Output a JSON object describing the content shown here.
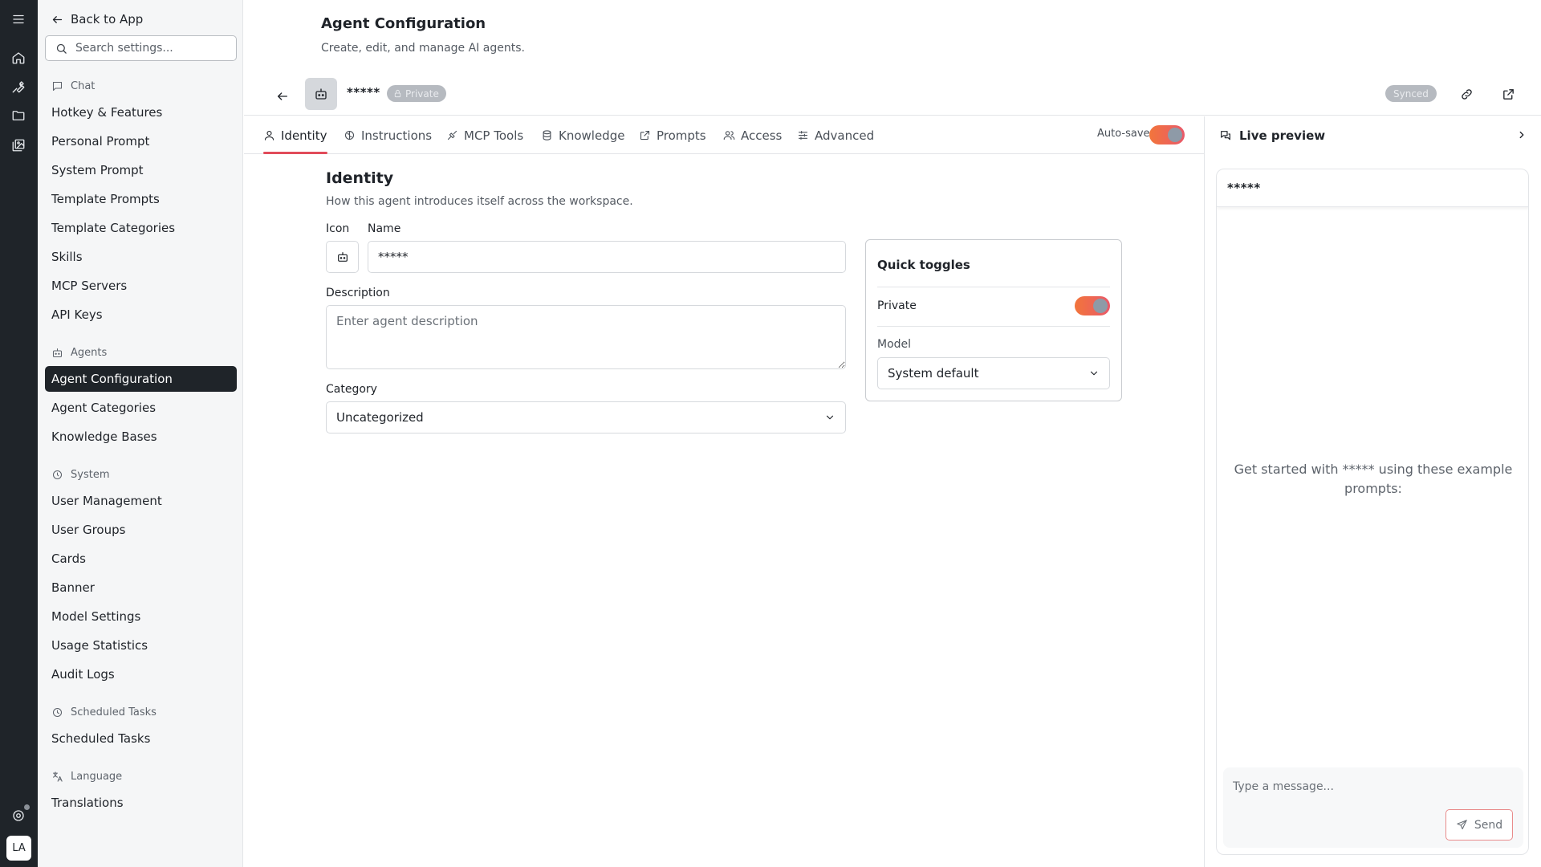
{
  "rail": {
    "avatar_initials": "LA",
    "icons": [
      "menu-icon",
      "home-icon",
      "wrench-icon",
      "folder-icon",
      "gallery-icon",
      "support-icon"
    ]
  },
  "sidebar": {
    "back_label": "Back to App",
    "search_placeholder": "Search settings...",
    "sections": {
      "chat": "Chat",
      "agents": "Agents",
      "system": "System",
      "scheduled": "Scheduled Tasks",
      "language": "Language"
    },
    "items": {
      "hotkey": "Hotkey & Features",
      "personal_prompt": "Personal Prompt",
      "system_prompt": "System Prompt",
      "template_prompts": "Template Prompts",
      "template_categories": "Template Categories",
      "skills": "Skills",
      "mcp_servers": "MCP Servers",
      "api_keys": "API Keys",
      "agent_configuration": "Agent Configuration",
      "agent_categories": "Agent Categories",
      "knowledge_bases": "Knowledge Bases",
      "user_management": "User Management",
      "user_groups": "User Groups",
      "cards": "Cards",
      "banner": "Banner",
      "model_settings": "Model Settings",
      "usage_statistics": "Usage Statistics",
      "audit_logs": "Audit Logs",
      "scheduled_tasks": "Scheduled Tasks",
      "translations": "Translations"
    },
    "active_item": "Agent Configuration"
  },
  "header": {
    "title": "Agent Configuration",
    "subtitle": "Create, edit, and manage AI agents."
  },
  "agent_bar": {
    "name": "*****",
    "private_badge": "Private",
    "synced_badge": "Synced"
  },
  "tabs": {
    "identity": "Identity",
    "instructions": "Instructions",
    "mcp_tools": "MCP Tools",
    "knowledge": "Knowledge",
    "prompts": "Prompts",
    "access": "Access",
    "advanced": "Advanced",
    "active": "Identity",
    "autosave_label": "Auto-save",
    "autosave_on": true
  },
  "identity": {
    "title": "Identity",
    "subtitle": "How this agent introduces itself across the workspace.",
    "icon_label": "Icon",
    "name_label": "Name",
    "name_value": "*****",
    "description_label": "Description",
    "description_placeholder": "Enter agent description",
    "category_label": "Category",
    "category_value": "Uncategorized"
  },
  "quick_toggles": {
    "title": "Quick toggles",
    "private_label": "Private",
    "private_on": true,
    "model_label": "Model",
    "model_value": "System default"
  },
  "preview": {
    "title": "Live preview",
    "agent_name": "*****",
    "empty_text": "Get started with ***** using these example prompts:",
    "input_placeholder": "Type a message...",
    "send_label": "Send"
  },
  "colors": {
    "accent": "#e14b5a",
    "toggle_start": "#f2753b",
    "toggle_end": "#e9596a",
    "dark": "#1f2429",
    "badge_gray": "#b6bac0"
  }
}
